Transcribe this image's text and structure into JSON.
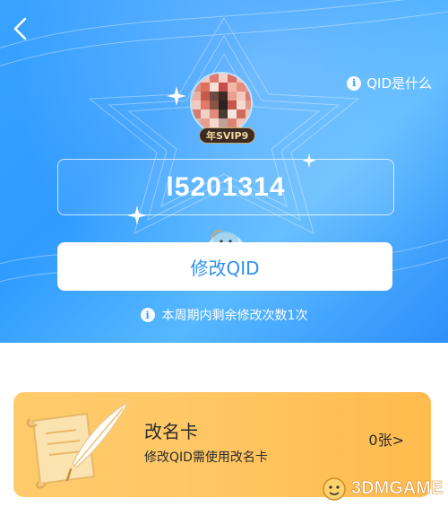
{
  "header": {
    "back_icon": "chevron-left-icon",
    "qid_help_label": "QID是什么",
    "qid_help_icon": "info-icon"
  },
  "profile": {
    "avatar_icon": "avatar",
    "badge": "年SVIP9"
  },
  "qid": {
    "value": "l5201314"
  },
  "actions": {
    "modify_label": "修改QID",
    "remaining_icon": "info-icon",
    "remaining_text": "本周期内剩余修改次数1次"
  },
  "rename_card": {
    "icon": "scroll-quill-icon",
    "title": "改名卡",
    "description": "修改QID需使用改名卡",
    "count": "0张>"
  },
  "watermark": {
    "text": "3DMGAME"
  },
  "colors": {
    "hero_blue": "#3aa2ff",
    "button_text": "#2f8ff0",
    "card_orange": "#ffc766"
  }
}
